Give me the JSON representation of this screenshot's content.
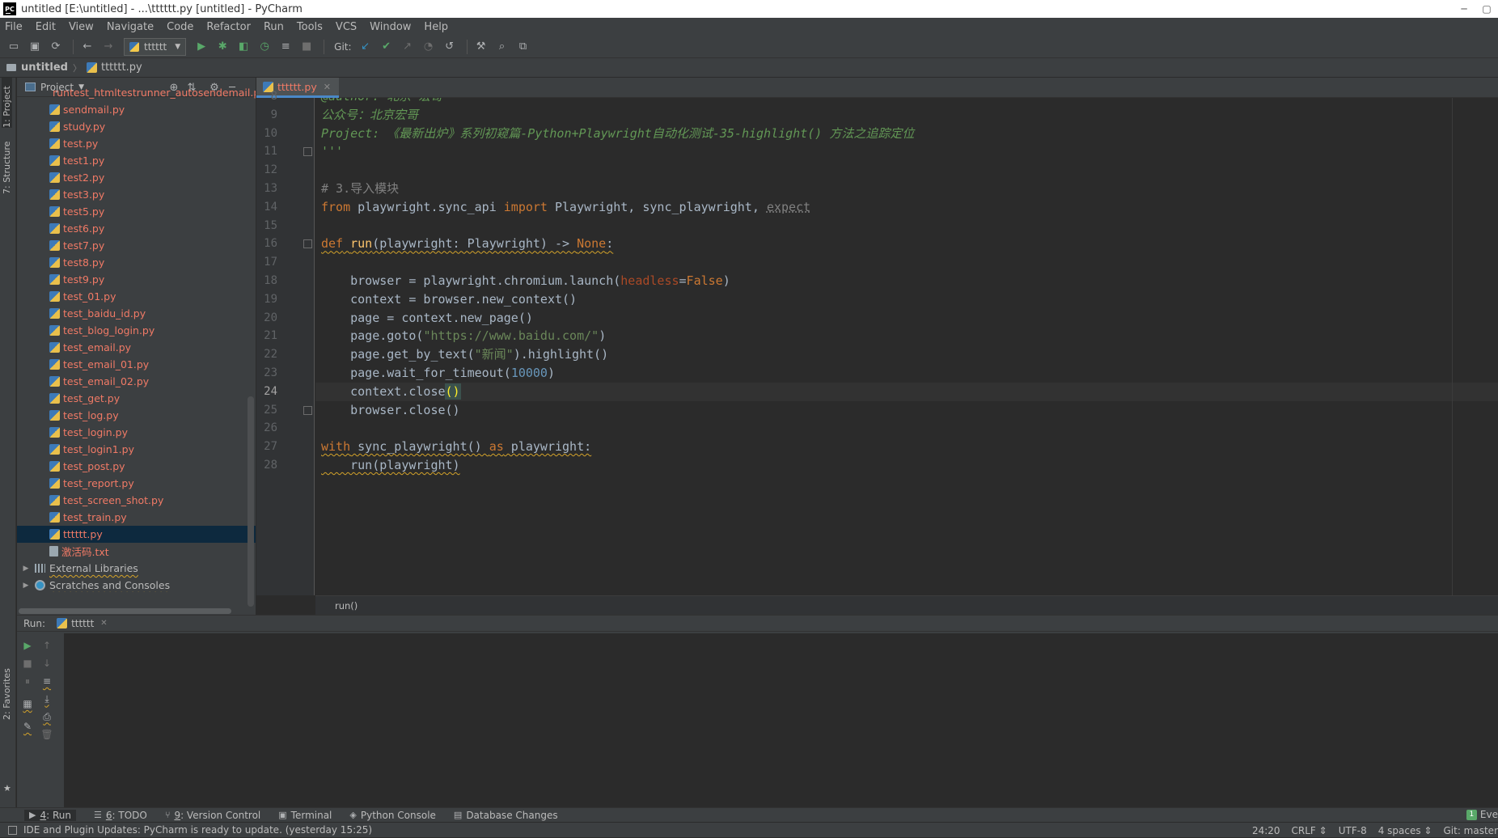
{
  "window": {
    "title": "untitled [E:\\untitled] - ...\\tttttt.py [untitled] - PyCharm",
    "logo": "PC"
  },
  "menu": [
    "File",
    "Edit",
    "View",
    "Navigate",
    "Code",
    "Refactor",
    "Run",
    "Tools",
    "VCS",
    "Window",
    "Help"
  ],
  "toolbar": {
    "run_config": "tttttt",
    "git_label": "Git:"
  },
  "breadcrumb": {
    "project": "untitled",
    "file": "tttttt.py"
  },
  "side_tools": {
    "project": "1: Project",
    "structure": "7: Structure",
    "favorites": "2: Favorites"
  },
  "project_panel": {
    "title": "Project",
    "files": [
      {
        "name": "runtest_htmltestrunner_autosendemail.py",
        "type": "py"
      },
      {
        "name": "sendmail.py",
        "type": "py"
      },
      {
        "name": "study.py",
        "type": "py"
      },
      {
        "name": "test.py",
        "type": "py"
      },
      {
        "name": "test1.py",
        "type": "py"
      },
      {
        "name": "test2.py",
        "type": "py"
      },
      {
        "name": "test3.py",
        "type": "py"
      },
      {
        "name": "test5.py",
        "type": "py"
      },
      {
        "name": "test6.py",
        "type": "py"
      },
      {
        "name": "test7.py",
        "type": "py"
      },
      {
        "name": "test8.py",
        "type": "py"
      },
      {
        "name": "test9.py",
        "type": "py"
      },
      {
        "name": "test_01.py",
        "type": "py"
      },
      {
        "name": "test_baidu_id.py",
        "type": "py"
      },
      {
        "name": "test_blog_login.py",
        "type": "py"
      },
      {
        "name": "test_email.py",
        "type": "py"
      },
      {
        "name": "test_email_01.py",
        "type": "py"
      },
      {
        "name": "test_email_02.py",
        "type": "py"
      },
      {
        "name": "test_get.py",
        "type": "py"
      },
      {
        "name": "test_log.py",
        "type": "py"
      },
      {
        "name": "test_login.py",
        "type": "py"
      },
      {
        "name": "test_login1.py",
        "type": "py"
      },
      {
        "name": "test_post.py",
        "type": "py"
      },
      {
        "name": "test_report.py",
        "type": "py"
      },
      {
        "name": "test_screen_shot.py",
        "type": "py"
      },
      {
        "name": "test_train.py",
        "type": "py"
      },
      {
        "name": "tttttt.py",
        "type": "py",
        "selected": true
      },
      {
        "name": "激活码.txt",
        "type": "txt"
      }
    ],
    "external_libraries": "External Libraries",
    "scratches": "Scratches and Consoles"
  },
  "editor": {
    "tab": "tttttt.py",
    "current_line": 24,
    "lines": [
      {
        "n": "8",
        "html": "<span class=\"d\">@author: 北京-宏哥</span>"
      },
      {
        "n": "9",
        "html": "<span class=\"d\">公众号：北京宏哥</span>"
      },
      {
        "n": "10",
        "html": "<span class=\"d\">Project: 《最新出炉》系列初窥篇-Python+Playwright自动化测试-35-highlight() 方法之追踪定位</span>"
      },
      {
        "n": "11",
        "html": "<span class=\"d\">'''</span>"
      },
      {
        "n": "12",
        "html": ""
      },
      {
        "n": "13",
        "html": "<span class=\"cm\"># 3.导入模块</span>"
      },
      {
        "n": "14",
        "html": "<span class=\"k\">from</span> playwright.sync_api <span class=\"k\">import</span> Playwright, sync_playwright, <span class=\"ex\">expect</span>"
      },
      {
        "n": "15",
        "html": ""
      },
      {
        "n": "16",
        "html": "<span class=\"w\"><span class=\"k\">def</span> <span style=\"color:#ffc66d\">run</span>(playwright: Playwright) -&gt; <span class=\"k\">None</span>:</span>"
      },
      {
        "n": "17",
        "html": ""
      },
      {
        "n": "18",
        "html": "    browser = playwright.chromium.launch(<span class=\"p\">headless</span>=<span class=\"k\">False</span>)"
      },
      {
        "n": "19",
        "html": "    context = browser.new_context()"
      },
      {
        "n": "20",
        "html": "    page = context.new_page()"
      },
      {
        "n": "21",
        "html": "    page.goto(<span class=\"s\">\"https://www.baidu.com/\"</span>)"
      },
      {
        "n": "22",
        "html": "    page.get_by_text(<span class=\"s\">\"新闻\"</span>).highlight()"
      },
      {
        "n": "23",
        "html": "    page.wait_for_timeout(<span class=\"n\">10000</span>)"
      },
      {
        "n": "24",
        "html": "    context.close<span class=\"brace\">()</span>"
      },
      {
        "n": "25",
        "html": "    browser.close()"
      },
      {
        "n": "26",
        "html": ""
      },
      {
        "n": "27",
        "html": "<span class=\"w\"><span class=\"k\">with</span> sync_playwright() <span class=\"k\">as</span> playwright:</span>"
      },
      {
        "n": "28",
        "html": "<span class=\"w\">    run(playwright)</span>"
      }
    ],
    "folds": [
      "11",
      "16",
      "25"
    ],
    "crumb": "run()"
  },
  "run_panel": {
    "label": "Run:",
    "tab": "tttttt"
  },
  "bottom_tabs": [
    {
      "key": "4",
      "label": ": Run",
      "icon": "▶",
      "active": true
    },
    {
      "key": "6",
      "label": ": TODO",
      "icon": "☰"
    },
    {
      "key": "9",
      "label": ": Version Control",
      "icon": "⑂"
    },
    {
      "key": "",
      "label": "Terminal",
      "icon": "▣"
    },
    {
      "key": "",
      "label": "Python Console",
      "icon": "◈"
    },
    {
      "key": "",
      "label": "Database Changes",
      "icon": "▤"
    }
  ],
  "event_log": "Eve",
  "status": {
    "message": "IDE and Plugin Updates: PyCharm is ready to update. (yesterday 15:25)",
    "position": "24:20",
    "line_sep": "CRLF ⇕",
    "encoding": "UTF-8",
    "indent": "4 spaces ⇕",
    "git": "Git: master"
  }
}
